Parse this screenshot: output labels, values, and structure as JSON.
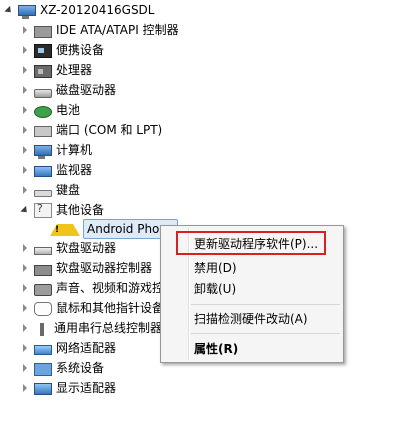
{
  "tree": {
    "root_label": "XZ-20120416GSDL",
    "categories": [
      {
        "label": "IDE ATA/ATAPI 控制器",
        "icon": "ide-controller-icon",
        "expanded": false
      },
      {
        "label": "便携设备",
        "icon": "portable-device-icon",
        "expanded": false
      },
      {
        "label": "处理器",
        "icon": "processor-icon",
        "expanded": false
      },
      {
        "label": "磁盘驱动器",
        "icon": "disk-drive-icon",
        "expanded": false
      },
      {
        "label": "电池",
        "icon": "battery-icon",
        "expanded": false
      },
      {
        "label": "端口 (COM 和 LPT)",
        "icon": "port-icon",
        "expanded": false
      },
      {
        "label": "计算机",
        "icon": "computer-icon",
        "expanded": false
      },
      {
        "label": "监视器",
        "icon": "monitor-icon",
        "expanded": false
      },
      {
        "label": "键盘",
        "icon": "keyboard-icon",
        "expanded": false
      },
      {
        "label": "其他设备",
        "icon": "unknown-device-icon",
        "expanded": true
      },
      {
        "label": "Android Phone",
        "icon": "warning-icon",
        "child": true
      },
      {
        "label": "软盘驱动器",
        "icon": "floppy-drive-icon",
        "expanded": false
      },
      {
        "label": "软盘驱动器控制器",
        "icon": "floppy-controller-icon",
        "expanded": false
      },
      {
        "label": "声音、视频和游戏控制器",
        "icon": "audio-icon",
        "expanded": false
      },
      {
        "label": "鼠标和其他指针设备",
        "icon": "mouse-icon",
        "expanded": false
      },
      {
        "label": "通用串行总线控制器",
        "icon": "usb-icon",
        "expanded": false
      },
      {
        "label": "网络适配器",
        "icon": "network-icon",
        "expanded": false
      },
      {
        "label": "系统设备",
        "icon": "system-icon",
        "expanded": false
      },
      {
        "label": "显示适配器",
        "icon": "display-icon",
        "expanded": false
      }
    ]
  },
  "context_menu": {
    "items": [
      {
        "label": "更新驱动程序软件(P)..."
      },
      {
        "label": "禁用(D)"
      },
      {
        "label": "卸载(U)"
      },
      {
        "label": "扫描检测硬件改动(A)"
      },
      {
        "label": "属性(R)"
      }
    ]
  },
  "colors": {
    "highlight_box": "#d92020",
    "selection_fill": "#dceaf9",
    "selection_border": "#7da2ce"
  }
}
